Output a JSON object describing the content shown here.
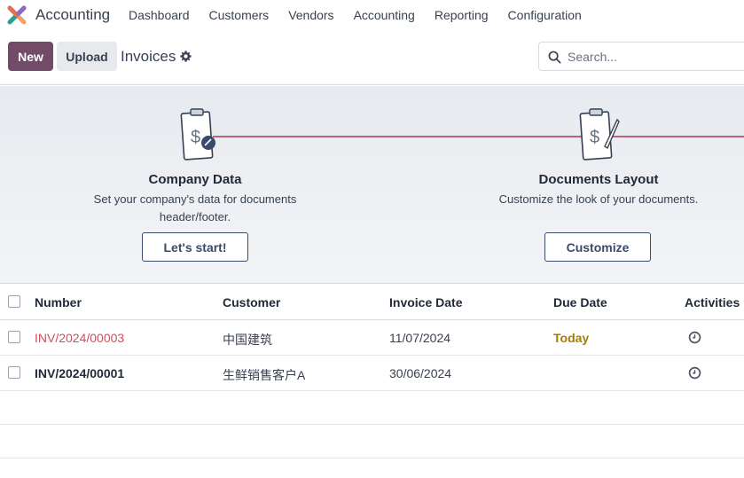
{
  "navbar": {
    "app_name": "Accounting",
    "menu": [
      "Dashboard",
      "Customers",
      "Vendors",
      "Accounting",
      "Reporting",
      "Configuration"
    ]
  },
  "control": {
    "new_label": "New",
    "upload_label": "Upload",
    "title": "Invoices",
    "search_placeholder": "Search..."
  },
  "onboarding": {
    "steps": [
      {
        "title": "Company Data",
        "desc_line1": "Set your company's data for documents",
        "desc_line2": "header/footer.",
        "button": "Let's start!"
      },
      {
        "title": "Documents Layout",
        "desc_line1": "Customize the look of your documents.",
        "button": "Customize"
      }
    ]
  },
  "table": {
    "headers": {
      "number": "Number",
      "customer": "Customer",
      "invoice_date": "Invoice Date",
      "due_date": "Due Date",
      "activities": "Activities"
    },
    "rows": [
      {
        "number": "INV/2024/00003",
        "customer": "中国建筑",
        "invoice_date": "11/07/2024",
        "due_date": "Today"
      },
      {
        "number": "INV/2024/00001",
        "customer": "生鲜销售客户A",
        "invoice_date": "30/06/2024",
        "due_date": ""
      }
    ]
  },
  "colors": {
    "brand": "#714b67",
    "overdue": "#d44c59",
    "today": "#a67c00",
    "accent_line": "#b96573"
  }
}
